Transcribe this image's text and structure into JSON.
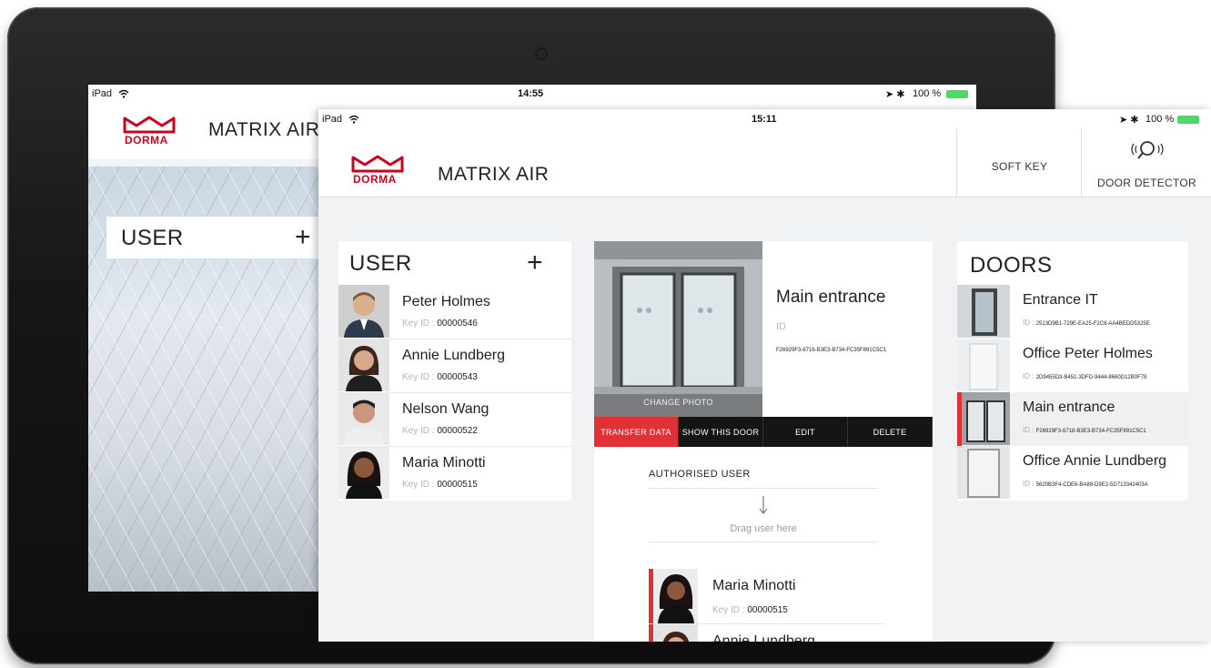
{
  "back": {
    "status": {
      "device": "iPad",
      "time": "14:55",
      "battery": "100 %"
    },
    "header": {
      "logo": "DORMA",
      "title": "MATRIX AIR"
    },
    "user_panel": {
      "title": "USER",
      "add": "+"
    }
  },
  "front": {
    "status": {
      "device": "iPad",
      "time": "15:11",
      "battery": "100 %"
    },
    "header": {
      "logo": "DORMA",
      "title": "MATRIX AIR",
      "soft_key": "SOFT KEY",
      "door_detector": "DOOR DETECTOR"
    },
    "users": {
      "title": "USER",
      "add": "+",
      "key_label": "Key ID :",
      "items": [
        {
          "name": "Peter Holmes",
          "key": "00000546"
        },
        {
          "name": "Annie Lundberg",
          "key": "00000543"
        },
        {
          "name": "Nelson Wang",
          "key": "00000522"
        },
        {
          "name": "Maria Minotti",
          "key": "00000515"
        }
      ]
    },
    "detail": {
      "name": "Main entrance",
      "id_label": "ID",
      "id": "F26929F3-6716-B3E3-B734-FC35F891C5C1",
      "change_photo": "CHANGE PHOTO",
      "actions": [
        "TRANSFER DATA",
        "SHOW THIS DOOR",
        "EDIT",
        "DELETE"
      ],
      "authorised_title": "AUTHORISED USER",
      "drag_hint": "Drag user here",
      "authorised": [
        {
          "name": "Maria Minotti",
          "key": "00000515"
        },
        {
          "name": "Annie Lundberg",
          "key": ""
        }
      ]
    },
    "doors": {
      "title": "DOORS",
      "id_label": "ID :",
      "items": [
        {
          "name": "Entrance IT",
          "id": "2513D9B1-729E-EA25-F2C6-AA4BEDD5325E",
          "selected": false
        },
        {
          "name": "Office Peter Holmes",
          "id": "2D9455D3-B451-3DFD-9444-8660D12B0F78",
          "selected": false
        },
        {
          "name": "Main entrance",
          "id": "F26929F3-6718-B3E3-B734-FC35F891C5C1",
          "selected": true
        },
        {
          "name": "Office Annie Lundberg",
          "id": "5620B3F4-CDE6-BA88-D9E2-5D713342403A",
          "selected": false
        }
      ]
    }
  },
  "colors": {
    "accent": "#e03236",
    "brand": "#d0021b",
    "battery": "#4cd964",
    "dark_bar": "#151515"
  }
}
